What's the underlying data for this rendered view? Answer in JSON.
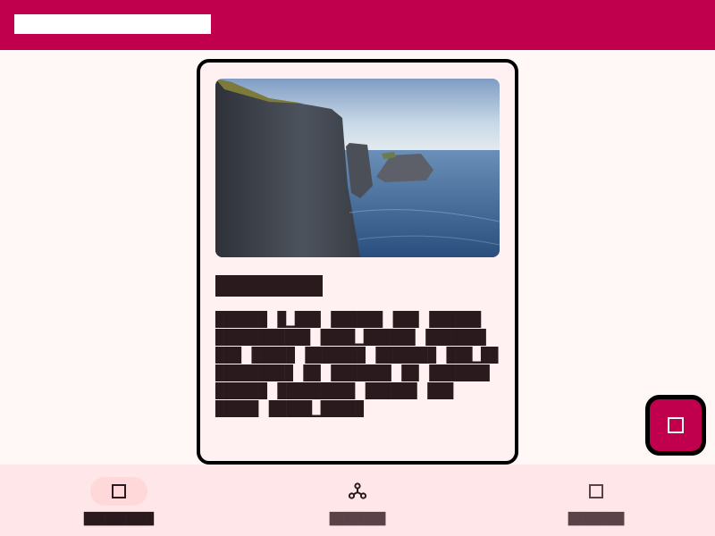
{
  "app_bar": {
    "title": "█████████████████████"
  },
  "card": {
    "title": "███████",
    "body": "██████ █▁███ ██████ ███ ██████ ███████████ ████▁██████ ███████ ███ █████ ███████ ███████ ███▁██ █████████ ██ ███████ ██ ███████ ██████ █████████ ██████ ███ █████ █████▁█████"
  },
  "fab": {
    "icon": "square-icon"
  },
  "bottom_nav": {
    "items": [
      {
        "label": "██████████",
        "icon": "square-icon",
        "active": true
      },
      {
        "label": "████████",
        "icon": "share-nodes-icon",
        "active": false
      },
      {
        "label": "████████",
        "icon": "square-icon",
        "active": false
      }
    ]
  },
  "colors": {
    "primary": "#c0004c",
    "background": "#fff8f6",
    "card_background": "#fff0f1",
    "nav_background": "#ffe6e8",
    "nav_active_indicator": "#ffd8da",
    "text": "#2a1a1e"
  }
}
